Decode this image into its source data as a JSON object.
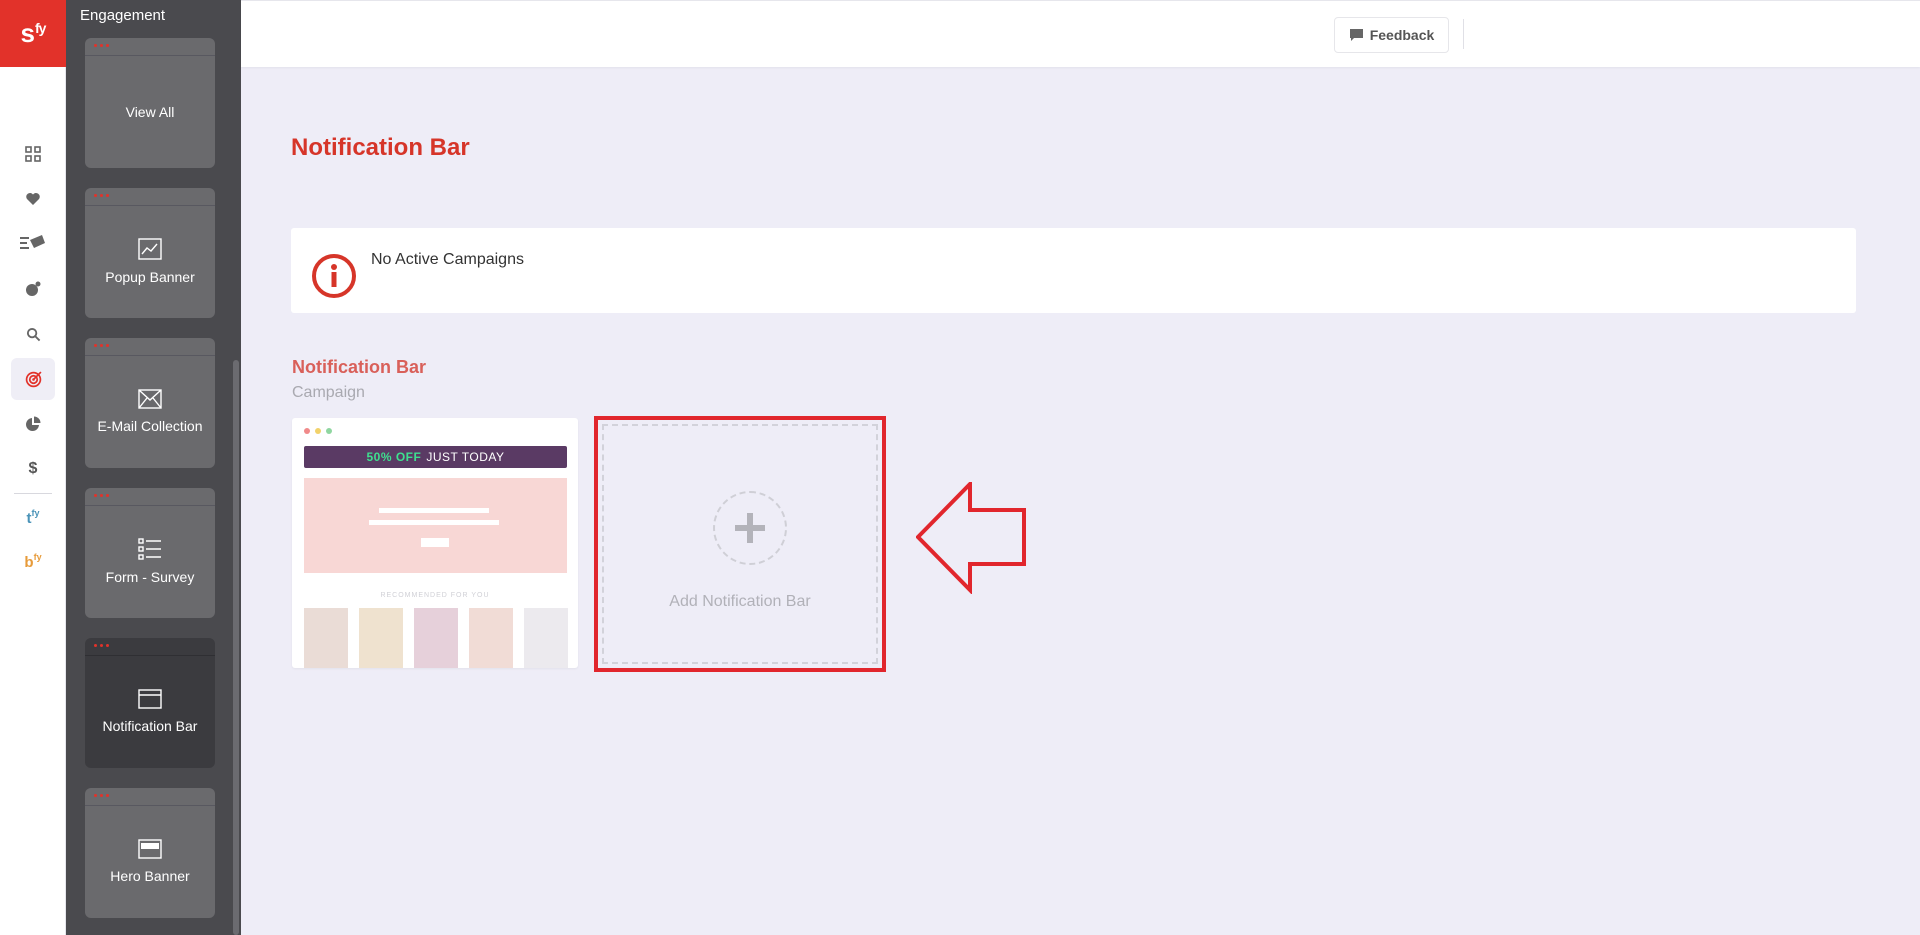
{
  "brand": {
    "logo_text": "s",
    "logo_sup": "fy",
    "accent": "#e2322a"
  },
  "rail": {
    "icons": [
      "grid-icon",
      "heart-icon",
      "megaphone-icon",
      "user-ball-icon",
      "search-icon",
      "target-icon",
      "pie-chart-icon",
      "dollar-icon"
    ],
    "active": "target-icon",
    "apps": [
      {
        "letter": "t",
        "sup": "fy",
        "color": "#4a93b8"
      },
      {
        "letter": "b",
        "sup": "fy",
        "color": "#e79b3a"
      }
    ]
  },
  "submenu": {
    "title": "Engagement",
    "items": [
      {
        "label": "View All",
        "icon": "none"
      },
      {
        "label": "Popup Banner",
        "icon": "image-icon"
      },
      {
        "label": "E-Mail Collection",
        "icon": "envelope-icon"
      },
      {
        "label": "Form - Survey",
        "icon": "list-icon"
      },
      {
        "label": "Notification Bar",
        "icon": "window-icon",
        "active": true
      },
      {
        "label": "Hero Banner",
        "icon": "banner-icon"
      }
    ]
  },
  "topbar": {
    "feedback_label": "Feedback"
  },
  "main": {
    "title": "Notification Bar",
    "info_message": "No Active Campaigns",
    "section_title": "Notification Bar",
    "section_subtitle": "Campaign",
    "preview": {
      "offer_highlight": "50% OFF",
      "offer_text": "JUST TODAY",
      "recommended_label": "RECOMMENDED FOR YOU"
    },
    "add_label": "Add Notification Bar"
  }
}
